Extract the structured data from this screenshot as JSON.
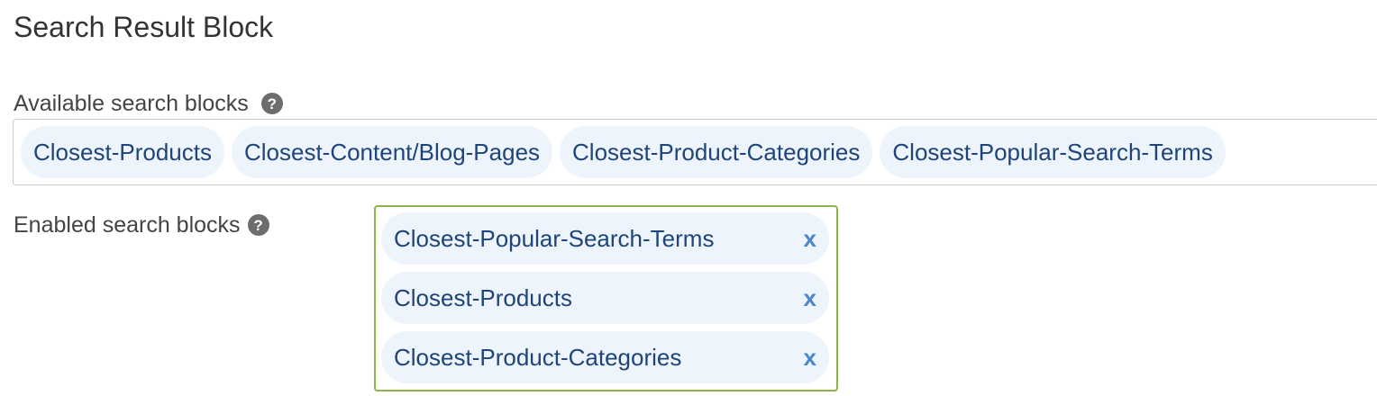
{
  "section": {
    "title": "Search Result Block"
  },
  "available": {
    "label": "Available search blocks",
    "help_icon": "?",
    "items": [
      {
        "label": "Closest-Products"
      },
      {
        "label": "Closest-Content/Blog-Pages"
      },
      {
        "label": "Closest-Product-Categories"
      },
      {
        "label": "Closest-Popular-Search-Terms"
      }
    ]
  },
  "enabled": {
    "label": "Enabled search blocks",
    "help_icon": "?",
    "remove_label": "x",
    "items": [
      {
        "label": "Closest-Popular-Search-Terms"
      },
      {
        "label": "Closest-Products"
      },
      {
        "label": "Closest-Product-Categories"
      }
    ]
  },
  "colors": {
    "chip_background": "#eef4fb",
    "chip_text": "#1f4479",
    "enabled_border": "#8db44a",
    "remove_x": "#4a86cc"
  },
  "icons": {
    "help": "question-circle-icon",
    "remove": "close-icon"
  }
}
